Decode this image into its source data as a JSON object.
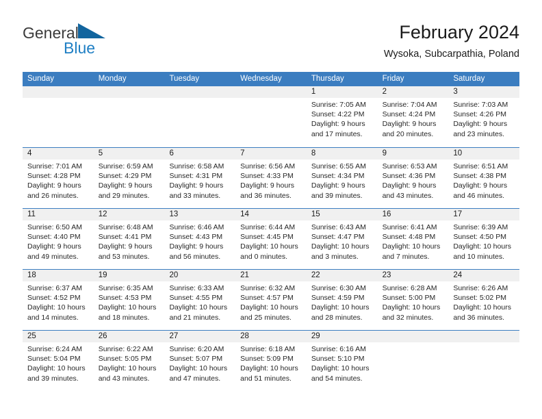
{
  "brand": {
    "name_dark": "General",
    "name_blue": "Blue",
    "triangle_color": "#12659e"
  },
  "header": {
    "title": "February 2024",
    "subtitle": "Wysoka, Subcarpathia, Poland"
  },
  "colors": {
    "header_blue": "#3b7dc0",
    "daynum_band": "#f0f0f0",
    "text": "#262626"
  },
  "weekdays": [
    "Sunday",
    "Monday",
    "Tuesday",
    "Wednesday",
    "Thursday",
    "Friday",
    "Saturday"
  ],
  "labels": {
    "sunrise_prefix": "Sunrise:",
    "sunset_prefix": "Sunset:",
    "daylight_prefix": "Daylight:"
  },
  "weeks": [
    [
      {
        "day": "",
        "l1": "",
        "l2": "",
        "l3": "",
        "l4": ""
      },
      {
        "day": "",
        "l1": "",
        "l2": "",
        "l3": "",
        "l4": ""
      },
      {
        "day": "",
        "l1": "",
        "l2": "",
        "l3": "",
        "l4": ""
      },
      {
        "day": "",
        "l1": "",
        "l2": "",
        "l3": "",
        "l4": ""
      },
      {
        "day": "1",
        "l1": "Sunrise: 7:05 AM",
        "l2": "Sunset: 4:22 PM",
        "l3": "Daylight: 9 hours",
        "l4": "and 17 minutes."
      },
      {
        "day": "2",
        "l1": "Sunrise: 7:04 AM",
        "l2": "Sunset: 4:24 PM",
        "l3": "Daylight: 9 hours",
        "l4": "and 20 minutes."
      },
      {
        "day": "3",
        "l1": "Sunrise: 7:03 AM",
        "l2": "Sunset: 4:26 PM",
        "l3": "Daylight: 9 hours",
        "l4": "and 23 minutes."
      }
    ],
    [
      {
        "day": "4",
        "l1": "Sunrise: 7:01 AM",
        "l2": "Sunset: 4:28 PM",
        "l3": "Daylight: 9 hours",
        "l4": "and 26 minutes."
      },
      {
        "day": "5",
        "l1": "Sunrise: 6:59 AM",
        "l2": "Sunset: 4:29 PM",
        "l3": "Daylight: 9 hours",
        "l4": "and 29 minutes."
      },
      {
        "day": "6",
        "l1": "Sunrise: 6:58 AM",
        "l2": "Sunset: 4:31 PM",
        "l3": "Daylight: 9 hours",
        "l4": "and 33 minutes."
      },
      {
        "day": "7",
        "l1": "Sunrise: 6:56 AM",
        "l2": "Sunset: 4:33 PM",
        "l3": "Daylight: 9 hours",
        "l4": "and 36 minutes."
      },
      {
        "day": "8",
        "l1": "Sunrise: 6:55 AM",
        "l2": "Sunset: 4:34 PM",
        "l3": "Daylight: 9 hours",
        "l4": "and 39 minutes."
      },
      {
        "day": "9",
        "l1": "Sunrise: 6:53 AM",
        "l2": "Sunset: 4:36 PM",
        "l3": "Daylight: 9 hours",
        "l4": "and 43 minutes."
      },
      {
        "day": "10",
        "l1": "Sunrise: 6:51 AM",
        "l2": "Sunset: 4:38 PM",
        "l3": "Daylight: 9 hours",
        "l4": "and 46 minutes."
      }
    ],
    [
      {
        "day": "11",
        "l1": "Sunrise: 6:50 AM",
        "l2": "Sunset: 4:40 PM",
        "l3": "Daylight: 9 hours",
        "l4": "and 49 minutes."
      },
      {
        "day": "12",
        "l1": "Sunrise: 6:48 AM",
        "l2": "Sunset: 4:41 PM",
        "l3": "Daylight: 9 hours",
        "l4": "and 53 minutes."
      },
      {
        "day": "13",
        "l1": "Sunrise: 6:46 AM",
        "l2": "Sunset: 4:43 PM",
        "l3": "Daylight: 9 hours",
        "l4": "and 56 minutes."
      },
      {
        "day": "14",
        "l1": "Sunrise: 6:44 AM",
        "l2": "Sunset: 4:45 PM",
        "l3": "Daylight: 10 hours",
        "l4": "and 0 minutes."
      },
      {
        "day": "15",
        "l1": "Sunrise: 6:43 AM",
        "l2": "Sunset: 4:47 PM",
        "l3": "Daylight: 10 hours",
        "l4": "and 3 minutes."
      },
      {
        "day": "16",
        "l1": "Sunrise: 6:41 AM",
        "l2": "Sunset: 4:48 PM",
        "l3": "Daylight: 10 hours",
        "l4": "and 7 minutes."
      },
      {
        "day": "17",
        "l1": "Sunrise: 6:39 AM",
        "l2": "Sunset: 4:50 PM",
        "l3": "Daylight: 10 hours",
        "l4": "and 10 minutes."
      }
    ],
    [
      {
        "day": "18",
        "l1": "Sunrise: 6:37 AM",
        "l2": "Sunset: 4:52 PM",
        "l3": "Daylight: 10 hours",
        "l4": "and 14 minutes."
      },
      {
        "day": "19",
        "l1": "Sunrise: 6:35 AM",
        "l2": "Sunset: 4:53 PM",
        "l3": "Daylight: 10 hours",
        "l4": "and 18 minutes."
      },
      {
        "day": "20",
        "l1": "Sunrise: 6:33 AM",
        "l2": "Sunset: 4:55 PM",
        "l3": "Daylight: 10 hours",
        "l4": "and 21 minutes."
      },
      {
        "day": "21",
        "l1": "Sunrise: 6:32 AM",
        "l2": "Sunset: 4:57 PM",
        "l3": "Daylight: 10 hours",
        "l4": "and 25 minutes."
      },
      {
        "day": "22",
        "l1": "Sunrise: 6:30 AM",
        "l2": "Sunset: 4:59 PM",
        "l3": "Daylight: 10 hours",
        "l4": "and 28 minutes."
      },
      {
        "day": "23",
        "l1": "Sunrise: 6:28 AM",
        "l2": "Sunset: 5:00 PM",
        "l3": "Daylight: 10 hours",
        "l4": "and 32 minutes."
      },
      {
        "day": "24",
        "l1": "Sunrise: 6:26 AM",
        "l2": "Sunset: 5:02 PM",
        "l3": "Daylight: 10 hours",
        "l4": "and 36 minutes."
      }
    ],
    [
      {
        "day": "25",
        "l1": "Sunrise: 6:24 AM",
        "l2": "Sunset: 5:04 PM",
        "l3": "Daylight: 10 hours",
        "l4": "and 39 minutes."
      },
      {
        "day": "26",
        "l1": "Sunrise: 6:22 AM",
        "l2": "Sunset: 5:05 PM",
        "l3": "Daylight: 10 hours",
        "l4": "and 43 minutes."
      },
      {
        "day": "27",
        "l1": "Sunrise: 6:20 AM",
        "l2": "Sunset: 5:07 PM",
        "l3": "Daylight: 10 hours",
        "l4": "and 47 minutes."
      },
      {
        "day": "28",
        "l1": "Sunrise: 6:18 AM",
        "l2": "Sunset: 5:09 PM",
        "l3": "Daylight: 10 hours",
        "l4": "and 51 minutes."
      },
      {
        "day": "29",
        "l1": "Sunrise: 6:16 AM",
        "l2": "Sunset: 5:10 PM",
        "l3": "Daylight: 10 hours",
        "l4": "and 54 minutes."
      },
      {
        "day": "",
        "l1": "",
        "l2": "",
        "l3": "",
        "l4": ""
      },
      {
        "day": "",
        "l1": "",
        "l2": "",
        "l3": "",
        "l4": ""
      }
    ]
  ]
}
